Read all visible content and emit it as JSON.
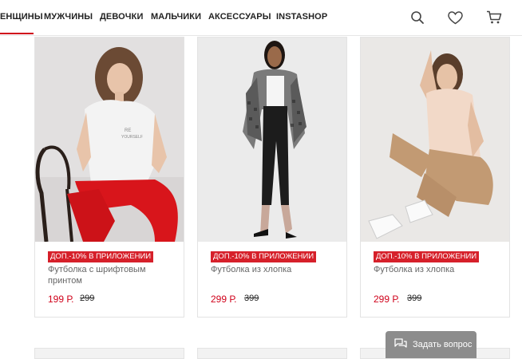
{
  "nav": {
    "items": [
      "ЕНЩИНЫ",
      "МУЖЧИНЫ",
      "ДЕВОЧКИ",
      "МАЛЬЧИКИ",
      "АКСЕССУАРЫ",
      "INSTASHOP"
    ],
    "icons": [
      "search-icon",
      "heart-icon",
      "cart-icon"
    ]
  },
  "products": [
    {
      "badge": "ДОП.-10% В ПРИЛОЖЕНИИ",
      "name": "Футболка с шрифтовым принтом",
      "price": "199 Р.",
      "old_price": "299"
    },
    {
      "badge": "ДОП.-10% В ПРИЛОЖЕНИИ",
      "name": "Футболка из хлопка",
      "price": "299 Р.",
      "old_price": "399"
    },
    {
      "badge": "ДОП.-10% В ПРИЛОЖЕНИИ",
      "name": "Футболка из хлопка",
      "price": "299 Р.",
      "old_price": "399"
    }
  ],
  "chat": {
    "label": "Задать вопрос"
  },
  "colors": {
    "accent": "#d0021b",
    "badge": "#d6202a"
  }
}
